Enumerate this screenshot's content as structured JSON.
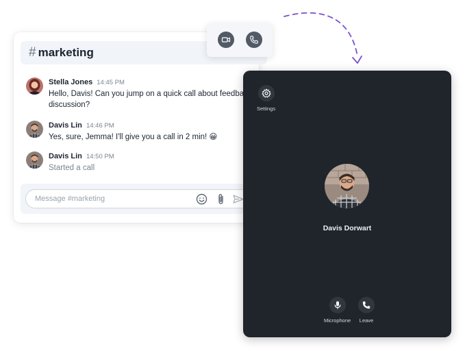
{
  "chat": {
    "channel_hash": "#",
    "channel_name": "marketing",
    "messages": [
      {
        "author": "Stella Jones",
        "time": "14:45 PM",
        "text": "Hello, Davis! Can you jump on a quick call about feedback\ndiscussion?"
      },
      {
        "author": "Davis Lin",
        "time": "14:46 PM",
        "text": "Yes, sure, Jemma! I'll give you a call in 2 min! 😀"
      },
      {
        "author": "Davis Lin",
        "time": "14:50 PM",
        "text": "Started a call"
      }
    ],
    "composer_placeholder": "Message #marketing",
    "composer_icons": [
      "emoji-icon",
      "paperclip-icon",
      "send-icon"
    ]
  },
  "call_actions": {
    "icons": [
      "video-camera-icon",
      "phone-icon"
    ]
  },
  "video_call": {
    "settings_label": "Settings",
    "participant_name": "Davis Dorwart",
    "controls": [
      {
        "label": "Microphone",
        "icon": "microphone-icon"
      },
      {
        "label": "Leave",
        "icon": "phone-icon"
      }
    ]
  },
  "colors": {
    "accent_arrow": "#7a4fd0",
    "video_bg": "#1f252b",
    "header_bg": "#f1f4f8"
  }
}
